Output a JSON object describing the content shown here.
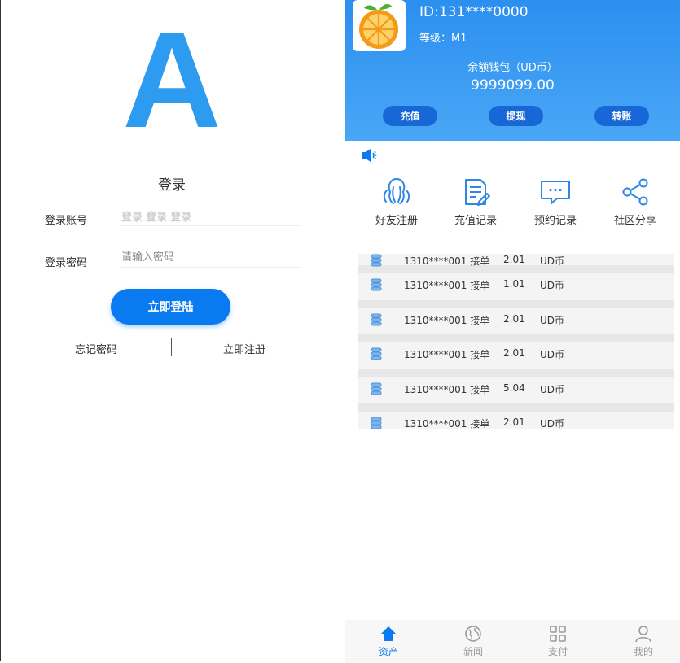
{
  "login": {
    "logo_letter": "A",
    "title": "登录",
    "account_label": "登录账号",
    "account_value": "登录 登录 登录",
    "password_label": "登录密码",
    "password_placeholder": "请输入密码",
    "submit_label": "立即登陆",
    "forgot_label": "忘记密码",
    "register_label": "立即注册"
  },
  "assets": {
    "user_id": "ID:131****0000",
    "level": "等级：M1",
    "wallet_label": "余额钱包（UD币）",
    "wallet_amount": "9999099.00",
    "actions": [
      {
        "label": "充值"
      },
      {
        "label": "提现"
      },
      {
        "label": "转账"
      }
    ],
    "notice_icon": "speaker-icon",
    "quick_links": [
      {
        "label": "好友注册",
        "icon": "friends-icon"
      },
      {
        "label": "充值记录",
        "icon": "document-edit-icon"
      },
      {
        "label": "预约记录",
        "icon": "chat-icon"
      },
      {
        "label": "社区分享",
        "icon": "share-icon"
      }
    ],
    "records": [
      {
        "who": "1310****001 接单",
        "amount": "2.01",
        "unit": "UD币"
      },
      {
        "who": "1310****001 接单",
        "amount": "1.01",
        "unit": "UD币"
      },
      {
        "who": "1310****001 接单",
        "amount": "2.01",
        "unit": "UD币"
      },
      {
        "who": "1310****001 接单",
        "amount": "2.01",
        "unit": "UD币"
      },
      {
        "who": "1310****001 接单",
        "amount": "5.04",
        "unit": "UD币"
      },
      {
        "who": "1310****001 接单",
        "amount": "2.01",
        "unit": "UD币"
      }
    ]
  },
  "tabbar": [
    {
      "label": "资产",
      "icon": "home-icon",
      "active": true
    },
    {
      "label": "新闻",
      "icon": "globe-icon",
      "active": false
    },
    {
      "label": "支付",
      "icon": "grid-icon",
      "active": false
    },
    {
      "label": "我的",
      "icon": "user-icon",
      "active": false
    }
  ],
  "colors": {
    "primary": "#0a7af0",
    "logo_blue": "#2d9bf0",
    "header_top": "#2b8ff0",
    "header_bottom": "#4aa7f5",
    "header_button": "#1767d6",
    "tab_inactive": "#9a9a9a"
  }
}
